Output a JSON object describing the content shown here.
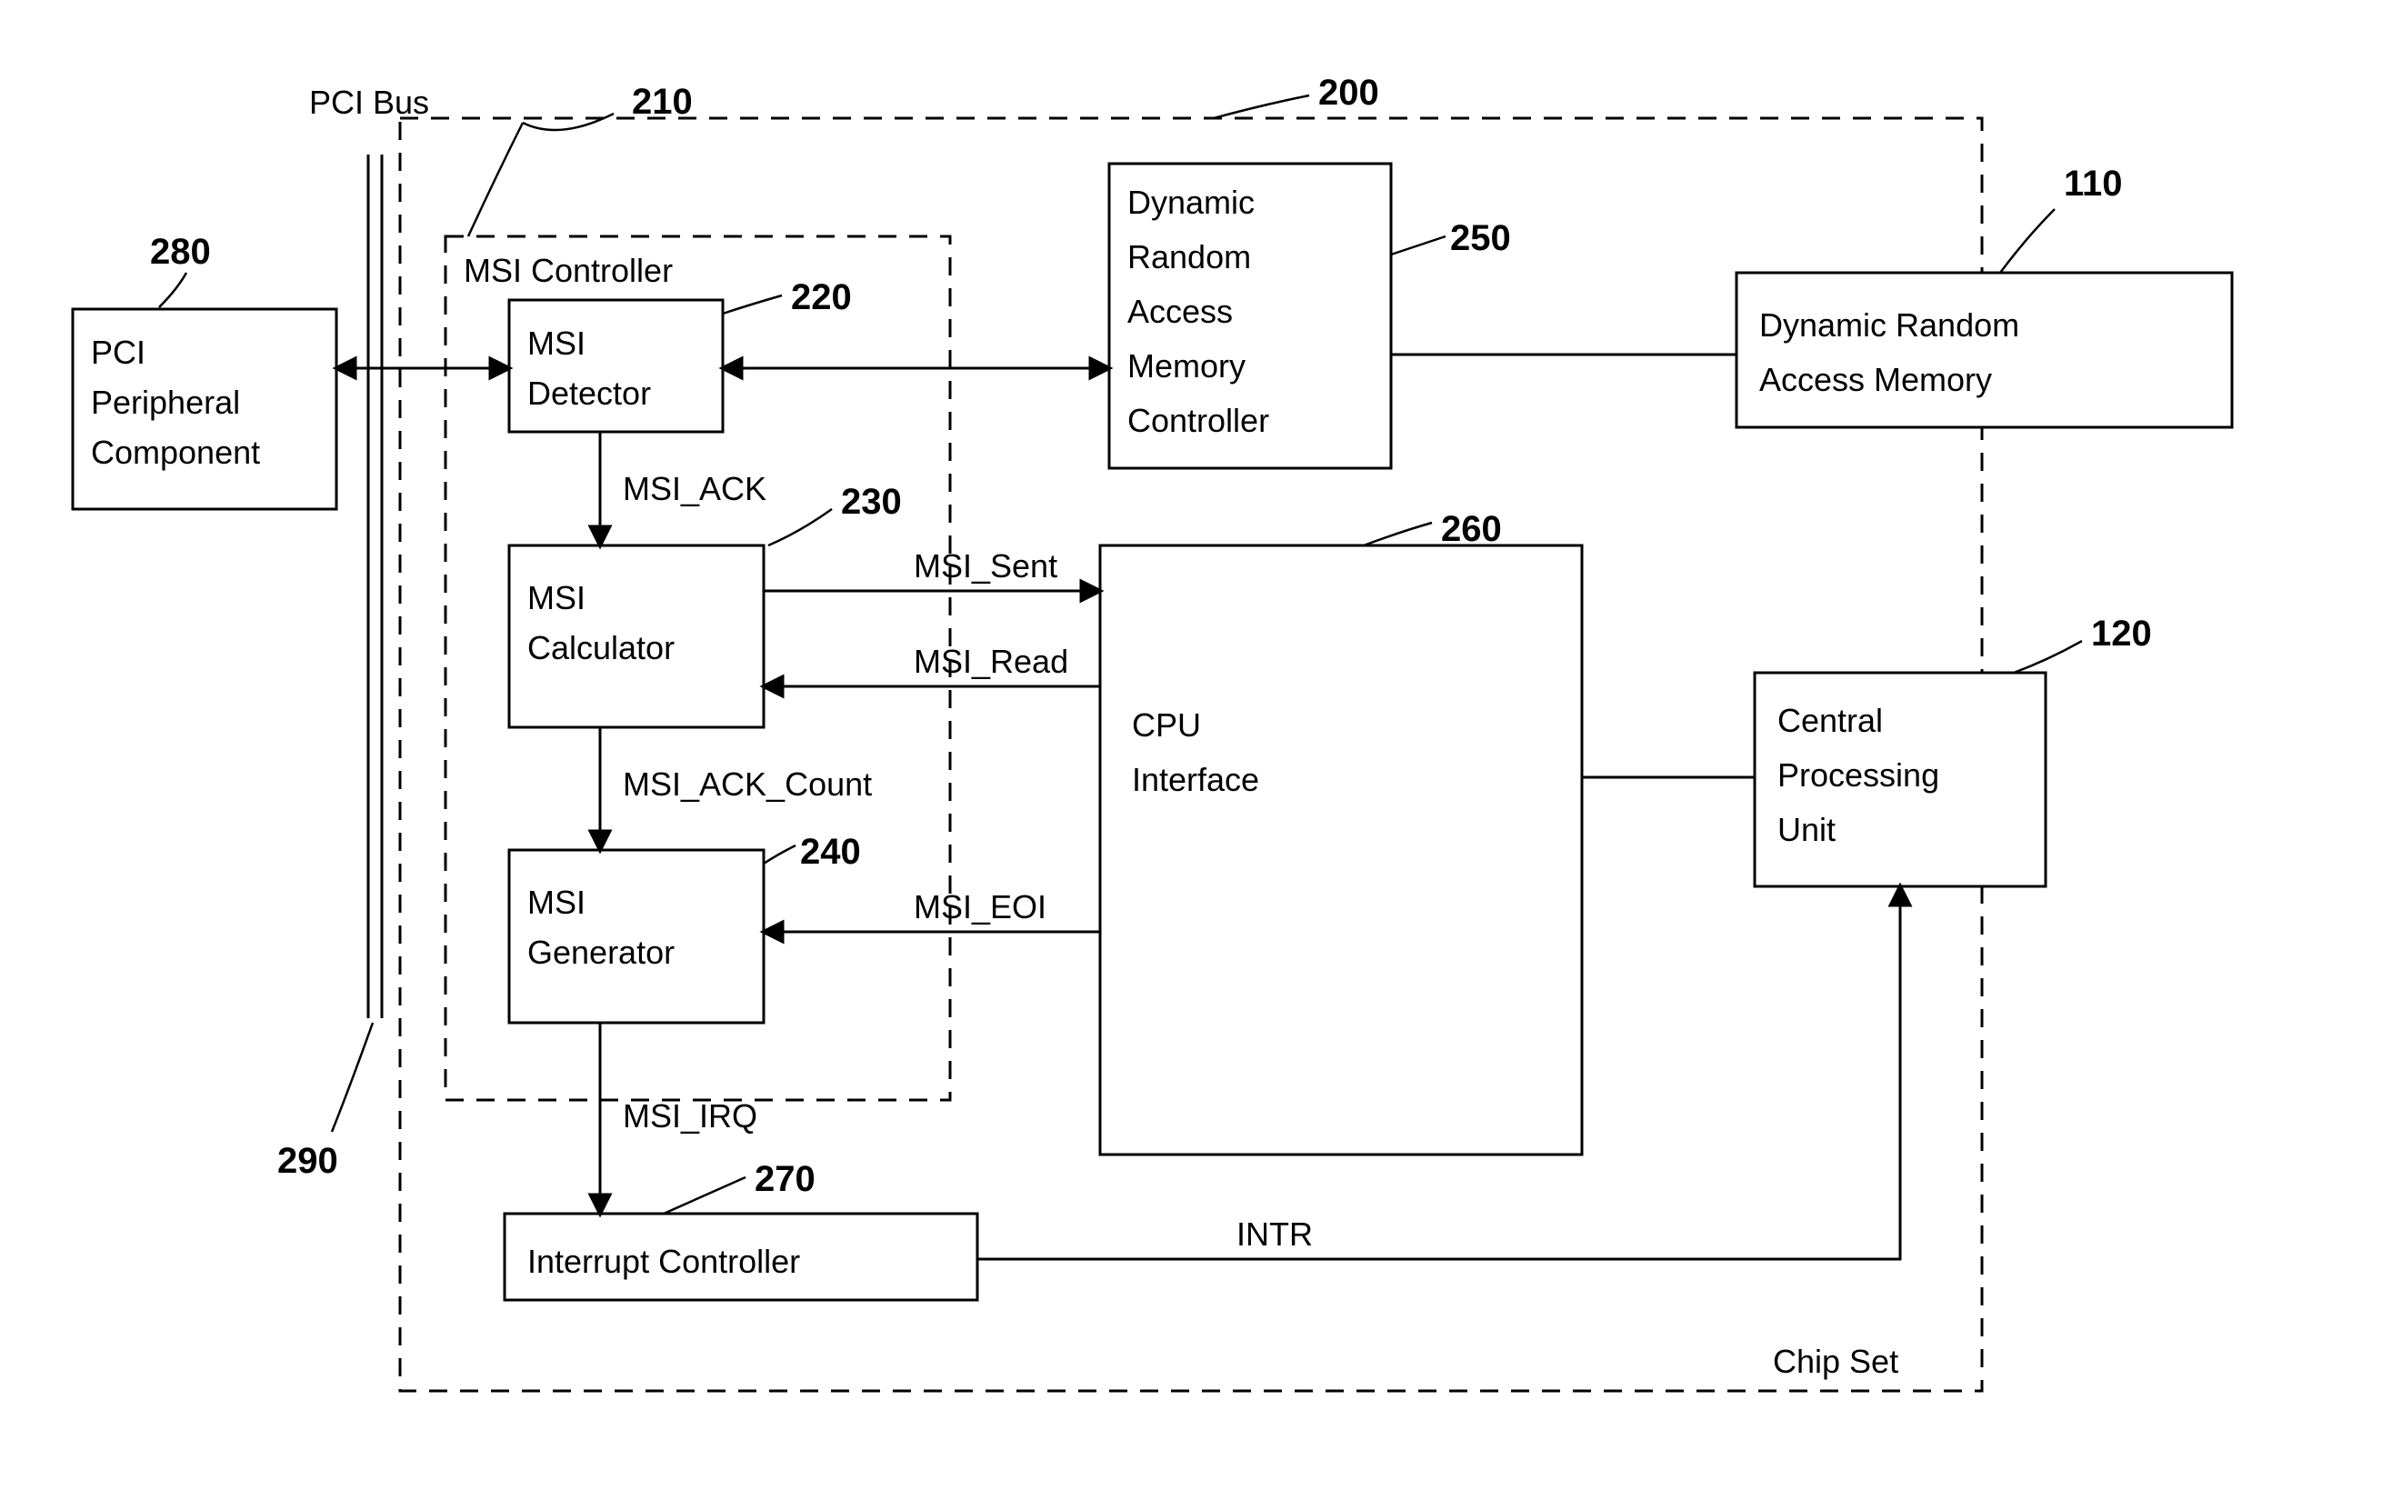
{
  "nums": {
    "n280": "280",
    "n290": "290",
    "n210": "210",
    "n220": "220",
    "n230": "230",
    "n240": "240",
    "n250": "250",
    "n260": "260",
    "n270": "270",
    "n200": "200",
    "n110": "110",
    "n120": "120"
  },
  "labels": {
    "pci_bus": "PCI Bus",
    "msi_controller": "MSI Controller",
    "chip_set": "Chip Set"
  },
  "blocks": {
    "pci_periph": [
      "PCI",
      "Peripheral",
      "Component"
    ],
    "msi_detector": [
      "MSI",
      "Detector"
    ],
    "msi_calculator": [
      "MSI",
      "Calculator"
    ],
    "msi_generator": [
      "MSI",
      "Generator"
    ],
    "interrupt_ctrl": [
      "Interrupt Controller"
    ],
    "dram_ctrl": [
      "Dynamic",
      "Random",
      "Access",
      "Memory",
      "Controller"
    ],
    "cpu_if": [
      "CPU",
      "Interface"
    ],
    "dram": [
      "Dynamic Random",
      "Access Memory"
    ],
    "cpu": [
      "Central",
      "Processing",
      "Unit"
    ]
  },
  "sig": {
    "msi_ack": "MSI_ACK",
    "msi_ack_count": "MSI_ACK_Count",
    "msi_irq": "MSI_IRQ",
    "msi_sent": "MSI_Sent",
    "msi_read": "MSI_Read",
    "msi_eoi": "MSI_EOI",
    "intr": "INTR"
  }
}
